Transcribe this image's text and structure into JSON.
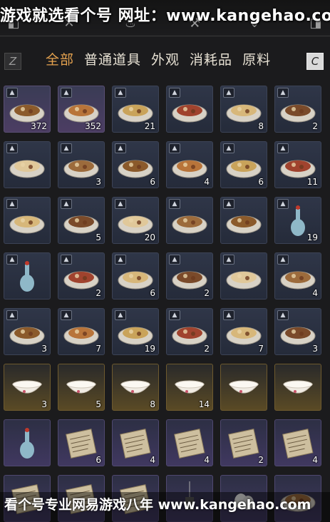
{
  "watermark_top": "游戏就选看个号 网址：www.kangehao.com",
  "watermark_bottom": "看个号专业网易游戏八年 www.kangehao.com",
  "keys": {
    "left": "Z",
    "right": "C"
  },
  "tabs": [
    {
      "label": "全部",
      "active": true
    },
    {
      "label": "普通道具",
      "active": false
    },
    {
      "label": "外观",
      "active": false
    },
    {
      "label": "消耗品",
      "active": false
    },
    {
      "label": "原料",
      "active": false
    }
  ],
  "grade_glyph": "▲",
  "items": [
    {
      "icon": "stew-pot-icon",
      "qty": "372",
      "frame": "purple",
      "graded": true
    },
    {
      "icon": "fried-buns-icon",
      "qty": "352",
      "frame": "purple",
      "graded": true
    },
    {
      "icon": "sliced-meat-plate-icon",
      "qty": "21",
      "frame": "blue",
      "graded": true
    },
    {
      "icon": "braised-pork-icon",
      "qty": "",
      "frame": "blue",
      "graded": true
    },
    {
      "icon": "mixed-dish-icon",
      "qty": "8",
      "frame": "blue",
      "graded": true
    },
    {
      "icon": "meat-platter-icon",
      "qty": "2",
      "frame": "blue",
      "graded": true
    },
    {
      "icon": "layered-cake-icon",
      "qty": "",
      "frame": "blue",
      "graded": true
    },
    {
      "icon": "flatbread-plate-icon",
      "qty": "3",
      "frame": "blue",
      "graded": true
    },
    {
      "icon": "egg-soup-icon",
      "qty": "6",
      "frame": "blue",
      "graded": true
    },
    {
      "icon": "pancake-stack-icon",
      "qty": "4",
      "frame": "blue",
      "graded": true
    },
    {
      "icon": "steamed-bun-icon",
      "qty": "6",
      "frame": "blue",
      "graded": true
    },
    {
      "icon": "noodle-bowl-icon",
      "qty": "11",
      "frame": "blue",
      "graded": true
    },
    {
      "icon": "noodle-soup-icon",
      "qty": "",
      "frame": "blue",
      "graded": true
    },
    {
      "icon": "vegetable-soup-icon",
      "qty": "5",
      "frame": "blue",
      "graded": true
    },
    {
      "icon": "millet-porridge-icon",
      "qty": "20",
      "frame": "blue",
      "graded": true
    },
    {
      "icon": "bean-soup-icon",
      "qty": "",
      "frame": "blue",
      "graded": true
    },
    {
      "icon": "rice-bowl-icon",
      "qty": "",
      "frame": "blue",
      "graded": true
    },
    {
      "icon": "wine-bottle-icon",
      "qty": "19",
      "frame": "blue",
      "graded": true
    },
    {
      "icon": "wine-vase-icon",
      "qty": "",
      "frame": "blue",
      "graded": true
    },
    {
      "icon": "fried-rice-icon",
      "qty": "2",
      "frame": "blue",
      "graded": true
    },
    {
      "icon": "dumplings-icon",
      "qty": "6",
      "frame": "blue",
      "graded": true
    },
    {
      "icon": "spicy-dish-icon",
      "qty": "2",
      "frame": "blue",
      "graded": true
    },
    {
      "icon": "clay-pot-icon",
      "qty": "",
      "frame": "blue",
      "graded": true
    },
    {
      "icon": "pork-belly-icon",
      "qty": "4",
      "frame": "blue",
      "graded": true
    },
    {
      "icon": "custard-bowl-icon",
      "qty": "3",
      "frame": "blue",
      "graded": true
    },
    {
      "icon": "fried-balls-icon",
      "qty": "7",
      "frame": "blue",
      "graded": true
    },
    {
      "icon": "fried-chicken-icon",
      "qty": "19",
      "frame": "blue",
      "graded": true
    },
    {
      "icon": "tofu-plate-icon",
      "qty": "2",
      "frame": "blue",
      "graded": true
    },
    {
      "icon": "pie-stack-icon",
      "qty": "7",
      "frame": "blue",
      "graded": true
    },
    {
      "icon": "pastry-board-icon",
      "qty": "3",
      "frame": "blue",
      "graded": true
    },
    {
      "icon": "porcelain-bowl-icon",
      "qty": "3",
      "frame": "gold",
      "graded": false
    },
    {
      "icon": "floral-bowl-icon",
      "qty": "5",
      "frame": "gold",
      "graded": false
    },
    {
      "icon": "painted-bowl-icon",
      "qty": "8",
      "frame": "gold",
      "graded": false
    },
    {
      "icon": "rooster-bowl-icon",
      "qty": "14",
      "frame": "gold",
      "graded": false
    },
    {
      "icon": "white-bowl-icon",
      "qty": "",
      "frame": "gold",
      "graded": false
    },
    {
      "icon": "shallow-dish-icon",
      "qty": "",
      "frame": "gold",
      "graded": false
    },
    {
      "icon": "celadon-jar-icon",
      "qty": "",
      "frame": "violet",
      "graded": false
    },
    {
      "icon": "scroll-book-icon",
      "qty": "6",
      "frame": "violet",
      "graded": false
    },
    {
      "icon": "parchment-icon",
      "qty": "4",
      "frame": "violet",
      "graded": false
    },
    {
      "icon": "recipe-paper-icon",
      "qty": "4",
      "frame": "violet",
      "graded": false
    },
    {
      "icon": "recipe-paper-icon",
      "qty": "2",
      "frame": "violet",
      "graded": false
    },
    {
      "icon": "recipe-paper-icon",
      "qty": "4",
      "frame": "violet",
      "graded": false
    },
    {
      "icon": "recipe-paper-icon",
      "qty": "",
      "frame": "violet",
      "graded": false
    },
    {
      "icon": "recipe-paper-icon",
      "qty": "",
      "frame": "violet",
      "graded": false
    },
    {
      "icon": "recipe-paper-icon",
      "qty": "",
      "frame": "violet",
      "graded": false
    },
    {
      "icon": "lantern-icon",
      "qty": "",
      "frame": "violet",
      "graded": false
    },
    {
      "icon": "eggs-icon",
      "qty": "",
      "frame": "violet",
      "graded": false
    },
    {
      "icon": "bread-loaf-icon",
      "qty": "",
      "frame": "violet",
      "graded": false
    }
  ]
}
